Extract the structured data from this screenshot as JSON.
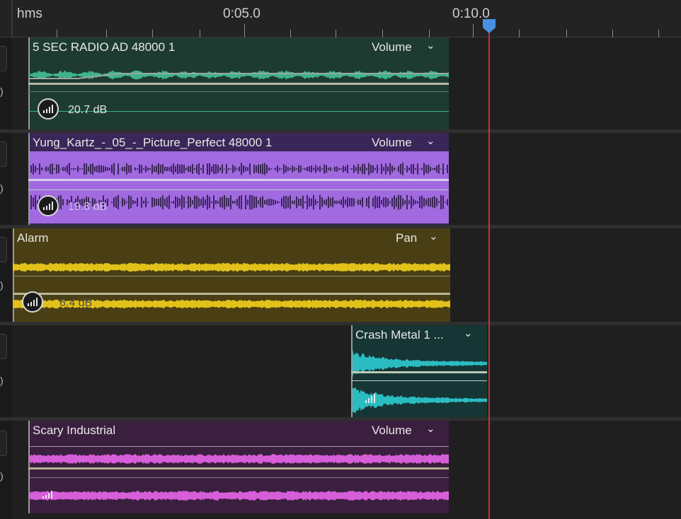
{
  "ruler": {
    "unit_label": "hms",
    "time_labels": [
      "0:05.0",
      "0:10.0"
    ]
  },
  "tracks": [
    {
      "clip_title": "5 SEC RADIO AD 48000 1",
      "effect_label": "Volume",
      "level_label": "20.7 dB",
      "color": "#1d3b31",
      "wave_color": "#3fb38d"
    },
    {
      "clip_title": "Yung_Kartz_-_05_-_Picture_Perfect 48000 1",
      "effect_label": "Volume",
      "level_label": "19.8 dB",
      "color": "#3a2658",
      "wave_color": "#a16ae0"
    },
    {
      "clip_title": "Alarm",
      "effect_label": "Pan",
      "level_label": "6.4 dB",
      "color": "#4a3f14",
      "wave_color": "#e2c21a"
    },
    {
      "clip_title": "Crash Metal 1 ...",
      "effect_label": "",
      "level_label": "",
      "color": "#163535",
      "wave_color": "#2bbcc2"
    },
    {
      "clip_title": "Scary Industrial",
      "effect_label": "Volume",
      "level_label": "",
      "color": "#3b1f3f",
      "wave_color": "#d65ed8"
    }
  ],
  "icons": {
    "dropdown": "chevron-down-icon",
    "meter": "level-meter-icon",
    "playhead": "playhead-marker-icon",
    "speaker": "speaker-icon"
  },
  "colors": {
    "playhead": "#c83232",
    "playhead_marker": "#4a90e2"
  }
}
